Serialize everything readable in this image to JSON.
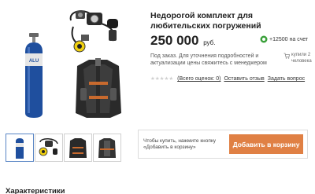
{
  "product": {
    "title": "Недорогой комплект для любительских погружений",
    "price": "250 000",
    "currency": "руб.",
    "bonus": "+12500 на счет",
    "availability": "Под заказ. Для уточнения подробностей и актуализации цены свяжитесь с менеджером",
    "buyers_line1": "купили 2",
    "buyers_line2": "человека",
    "rating_stars": 0,
    "rating_count": "(Всего оценок: 0)",
    "review_link": "Оставить отзыв",
    "question_link": "Задать вопрос"
  },
  "thumbnails": [
    {
      "name": "thumb-tank",
      "active": true
    },
    {
      "name": "thumb-regulator",
      "active": false
    },
    {
      "name": "thumb-bcd-front",
      "active": false
    },
    {
      "name": "thumb-bcd-back",
      "active": false
    }
  ],
  "buy_box": {
    "hint": "Чтобы купить, нажмите кнопку «Добавить в корзину»",
    "button_label": "Добавить в корзину"
  },
  "sections": {
    "characteristics": "Характеристики"
  },
  "colors": {
    "button": "#e08044",
    "tank": "#1f4f9e",
    "bonus": "#3aa03a"
  }
}
